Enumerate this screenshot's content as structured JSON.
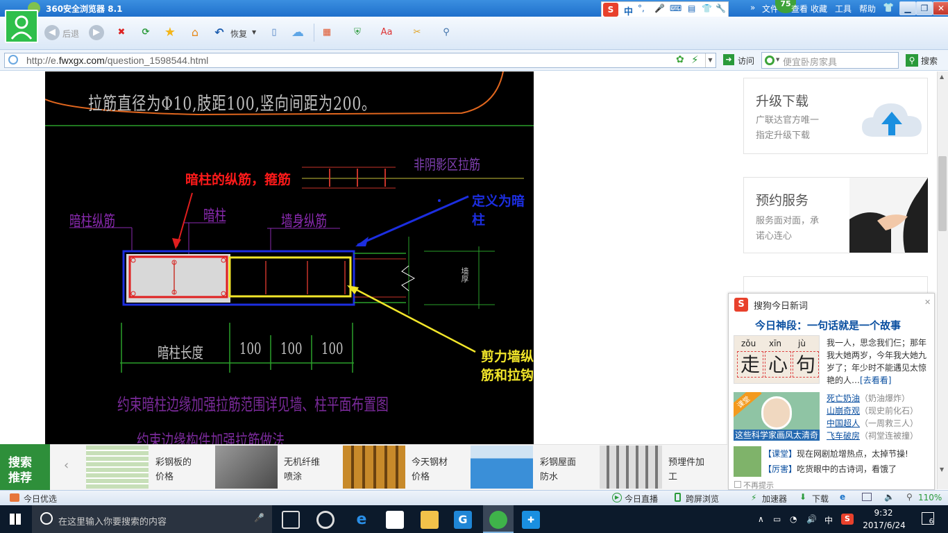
{
  "window": {
    "title": "360安全浏览器 8.1",
    "menu": [
      "文件",
      "查看",
      "收藏",
      "工具",
      "帮助"
    ],
    "badge": "75",
    "ime_label": "中"
  },
  "toolbar": {
    "back_label": "后退",
    "restore_label": "恢复"
  },
  "address": {
    "url_prefix": "http://e.",
    "url_domain": "fwxgx.com",
    "url_path": "/question_1598544.html",
    "visit_label": "访问",
    "search_placeholder": "便宜卧房家具",
    "search_label": "搜索"
  },
  "cad": {
    "top_text": "拉筋直径为Φ10,肢距100,竖向间距为200。",
    "non_shadow": "非阴影区拉筋",
    "red_title": "暗柱的纵筋，箍筋",
    "blue_title": "定义为暗柱",
    "left_label": "暗柱纵筋",
    "col_label": "暗柱",
    "wall_label": "墙身纵筋",
    "wall_thick": "墙厚",
    "yellow_title": "剪力墙纵筋和拉钩",
    "length_label": "暗柱长度",
    "dims": [
      "100",
      "100",
      "100"
    ],
    "bottom1": "约束暗柱边缘加强拉筋范围详见墙、柱平面布置图",
    "bottom2": "约束边缘构件加强拉筋做法"
  },
  "sidebar": {
    "cards": [
      {
        "title": "升级下载",
        "desc1": "广联达官方唯一",
        "desc2": "指定升级下载"
      },
      {
        "title": "预约服务",
        "desc1": "服务面对面，承",
        "desc2": "诺心连心"
      }
    ]
  },
  "popup": {
    "header": "搜狗今日新词",
    "headline": "今日神段：一句话就是一个故事",
    "pinyin": [
      "zǒu",
      "xīn",
      "jù"
    ],
    "chars": [
      "走",
      "心",
      "句"
    ],
    "story": "我一人，思念我们仨；那年我大她两岁，今年我大她九岁了；年少时不能遇见太惊艳的人…",
    "story_link": "[去看看]",
    "img_badge": "课堂",
    "img_caption": "这些科学家画风太清奇",
    "terms": [
      {
        "word": "死亡奶油",
        "note": "（奶油爆炸）"
      },
      {
        "word": "山崩奇观",
        "note": "（现史前化石）"
      },
      {
        "word": "中国超人",
        "note": "（一周救三人）"
      },
      {
        "word": "飞车破房",
        "note": "（祠堂连被撞）"
      }
    ],
    "news": [
      {
        "tag": "【课堂】",
        "text": "现在网剧尬增热点，太掉节操!"
      },
      {
        "tag": "【厉害】",
        "text": "吃货眼中的古诗词，看饿了"
      }
    ],
    "no_remind": "不再提示"
  },
  "strip": {
    "tag1": "搜索",
    "tag2": "推荐",
    "items": [
      {
        "l1": "彩钢板的",
        "l2": "价格"
      },
      {
        "l1": "无机纤维",
        "l2": "喷涂"
      },
      {
        "l1": "今天钢材",
        "l2": "价格"
      },
      {
        "l1": "彩钢屋面",
        "l2": "防水"
      },
      {
        "l1": "预埋件加",
        "l2": "工"
      }
    ]
  },
  "status": {
    "left": "今日优选",
    "live": "今日直播",
    "cross": "跨屏浏览",
    "accel": "加速器",
    "download": "下载",
    "zoom": "110%"
  },
  "taskbar": {
    "search_placeholder": "在这里输入你要搜索的内容",
    "time": "9:32",
    "date": "2017/6/24",
    "lang": "中",
    "notif": "6"
  }
}
